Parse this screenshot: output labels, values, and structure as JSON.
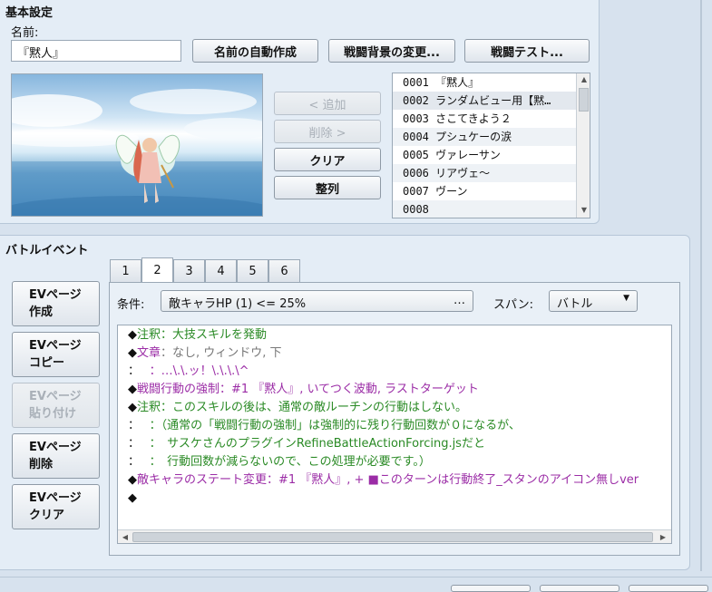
{
  "basic": {
    "title": "基本設定",
    "name_label": "名前:",
    "name_value": "『黙人』",
    "auto_name_button": "名前の自動作成",
    "change_bg_button": "戦闘背景の変更...",
    "battle_test_button": "戦闘テスト...",
    "add_button": "< 追加",
    "remove_button": "削除 >",
    "clear_button": "クリア",
    "sort_button": "整列",
    "enemies": [
      "0001 『黙人』",
      "0002 ランダムビュー用【黙…",
      "0003 さこてきよう２",
      "0004 プシュケーの涙",
      "0005 ヴァレーサン",
      "0006 リアヴェ～",
      "0007 ヴーン",
      "0008"
    ]
  },
  "battle_event": {
    "title": "バトルイベント",
    "tabs": [
      "1",
      "2",
      "3",
      "4",
      "5",
      "6"
    ],
    "active_tab": "2",
    "ev_buttons": [
      {
        "line1": "EVページ",
        "line2": "作成",
        "disabled": false
      },
      {
        "line1": "EVページ",
        "line2": "コピー",
        "disabled": false
      },
      {
        "line1": "EVページ",
        "line2": "貼り付け",
        "disabled": true
      },
      {
        "line1": "EVページ",
        "line2": "削除",
        "disabled": false
      },
      {
        "line1": "EVページ",
        "line2": "クリア",
        "disabled": false
      }
    ],
    "condition_label": "条件:",
    "condition_value": "敵キャラHP (1) <= 25%",
    "condition_more": "…",
    "span_label": "スパン:",
    "span_value": "バトル",
    "commands": [
      {
        "a": "◆",
        "b": "注釈：大技スキルを発動",
        "c": "",
        "bcolor": "green"
      },
      {
        "a": "◆",
        "b": "文章",
        "c": "：なし, ウィンドウ, 下",
        "bcolor": "purple"
      },
      {
        "a": "：",
        "b": "　 ：…\\.\\.ッ！\\.\\.\\.\\^",
        "c": "",
        "bcolor": "purple"
      },
      {
        "a": "◆",
        "b": "戦闘行動の強制：#1 『黙人』, いてつく波動, ラストターゲット",
        "c": "",
        "bcolor": "purple"
      },
      {
        "a": "◆",
        "b": "注釈：このスキルの後は、通常の敵ルーチンの行動はしない。",
        "c": "",
        "bcolor": "green"
      },
      {
        "a": "：",
        "b": "　 ：（通常の「戦闘行動の強制」は強制的に残り行動回数が０になるが、",
        "c": "",
        "bcolor": "green"
      },
      {
        "a": "：",
        "b": "　 ：　サスケさんのプラグインRefineBattleActionForcing.jsだと",
        "c": "",
        "bcolor": "green"
      },
      {
        "a": "：",
        "b": "　 ：　行動回数が減らないので、この処理が必要です。）",
        "c": "",
        "bcolor": "green"
      },
      {
        "a": "◆",
        "b": "敵キャラのステート変更：#1 『黙人』, + ■このターンは行動終了_スタンのアイコン無しver",
        "c": "",
        "bcolor": "purple"
      },
      {
        "a": "◆",
        "b": "",
        "c": "",
        "bcolor": "purple"
      }
    ]
  },
  "colors": {
    "green": "#2a8a25",
    "purple": "#9b2ca6"
  }
}
